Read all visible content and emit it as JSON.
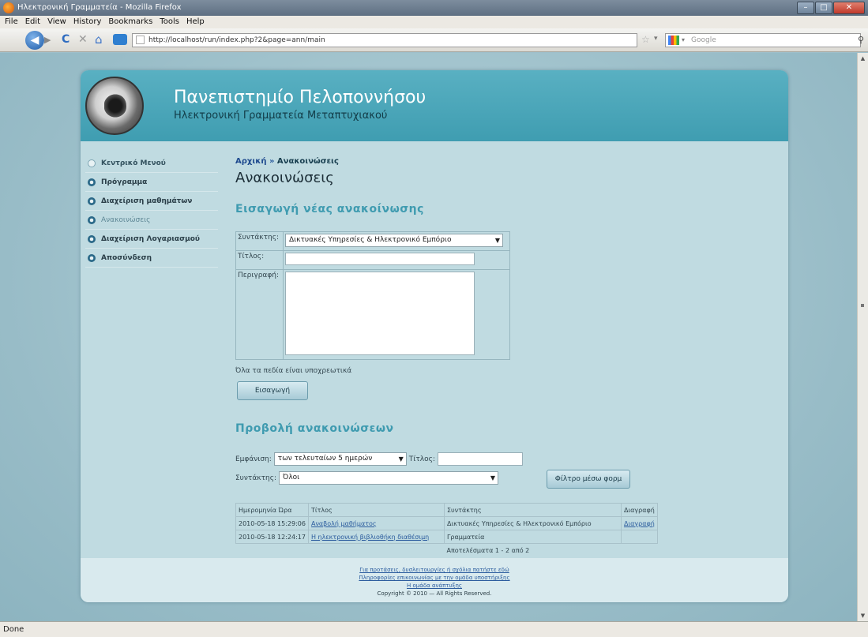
{
  "window": {
    "title": "Ηλεκτρονική Γραμματεία - Mozilla Firefox"
  },
  "menu": [
    "File",
    "Edit",
    "View",
    "History",
    "Bookmarks",
    "Tools",
    "Help"
  ],
  "nav": {
    "url": "http://localhost/run/index.php?2&page=ann/main",
    "search_placeholder": "Google"
  },
  "status": "Done",
  "header": {
    "title": "Πανεπιστημίο Πελοποννήσου",
    "subtitle": "Ηλεκτρονική Γραμματεία Μεταπτυχιακού"
  },
  "sidebar": {
    "items": [
      {
        "label": "Κεντρικό Μενού",
        "state": "home"
      },
      {
        "label": "Πρόγραμμα",
        "state": "normal"
      },
      {
        "label": "Διαχείριση μαθημάτων",
        "state": "normal"
      },
      {
        "label": "Ανακοινώσεις",
        "state": "active"
      },
      {
        "label": "Διαχείριση Λογαριασμού",
        "state": "normal"
      },
      {
        "label": "Αποσύνδεση",
        "state": "normal"
      }
    ]
  },
  "breadcrumb": {
    "home": "Αρχική",
    "sep": "»",
    "current": "Ανακοινώσεις"
  },
  "page_title": "Ανακοινώσεις",
  "insert_section": {
    "heading": "Εισαγωγή νέας ανακοίνωσης",
    "author_label": "Συντάκτης:",
    "author_value": "Δικτυακές Υπηρεσίες & Ηλεκτρονικό Εμπόριο",
    "title_label": "Τίτλος:",
    "description_label": "Περιγραφή:",
    "required_note": "Όλα τα πεδία είναι υποχρεωτικά",
    "submit_label": "Εισαγωγή"
  },
  "view_section": {
    "heading": "Προβολή ανακοινώσεων",
    "show_label": "Εμφάνιση:",
    "show_value": "των τελευταίων 5 ημερών",
    "title_label": "Τίτλος:",
    "author_label": "Συντάκτης:",
    "author_value": "Όλοι",
    "filter_button": "Φίλτρο μέσω φορμ",
    "table": {
      "headers": [
        "Ημερομηνία Ώρα",
        "Τίτλος",
        "Συντάκτης",
        "Διαγραφή"
      ],
      "rows": [
        [
          "2010-05-18 15:29:06",
          "Αναβολή μαθήματος",
          "Δικτυακές Υπηρεσίες & Ηλεκτρονικό Εμπόριο",
          "Διαγραφή"
        ],
        [
          "2010-05-18 12:24:17",
          "Η ηλεκτρονική βιβλιοθήκη διαθέσιμη",
          "Γραμματεία",
          ""
        ]
      ],
      "footer": "Αποτελέσματα 1 - 2 από 2"
    }
  },
  "footer": {
    "line1": "Για προτάσεις, δυσλειτουργίες ή σχόλια πατήστε εδώ",
    "line2": "Πληροφορίες επικοινωνίας με την ομάδα υποστήριξης",
    "line3": "Η ομάδα ανάπτυξης",
    "line4": "Copyright © 2010 — All Rights Reserved."
  }
}
